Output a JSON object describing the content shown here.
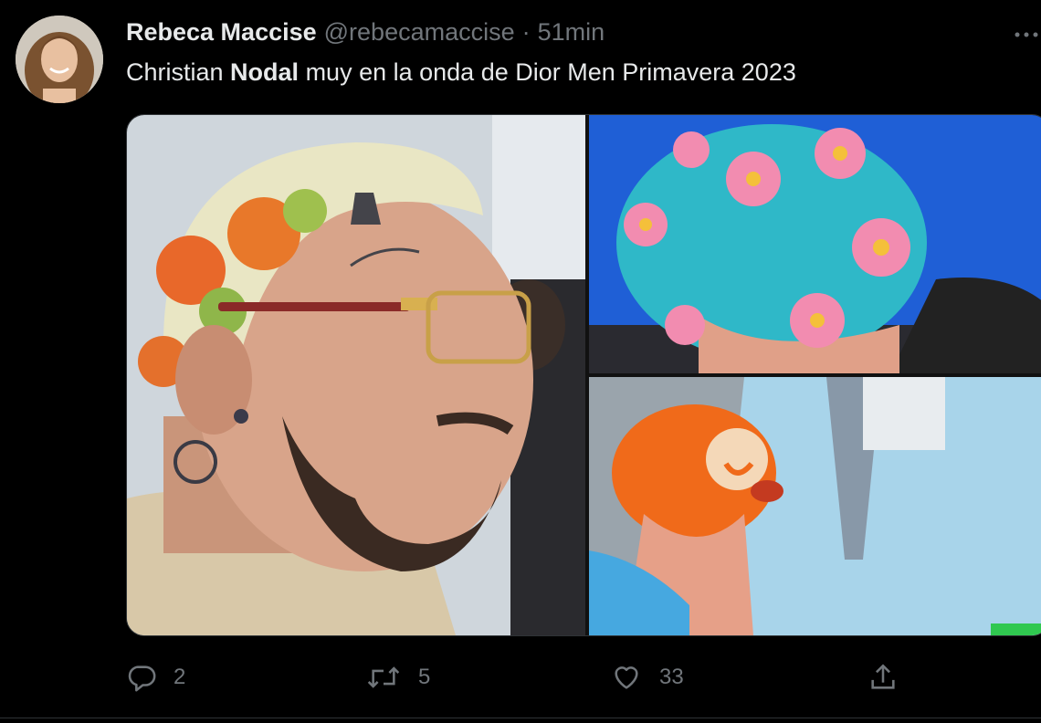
{
  "tweet": {
    "display_name": "Rebeca Maccise",
    "handle": "@rebecamaccise",
    "separator": "·",
    "time": "51min",
    "more_icon": "more-horizontal-icon",
    "text_prefix": "Christian ",
    "text_bold": "Nodal",
    "text_suffix": " muy en la onda de Dior Men Primavera 2023"
  },
  "media": {
    "photos": [
      {
        "alt": "photo-1"
      },
      {
        "alt": "photo-2"
      },
      {
        "alt": "photo-3"
      }
    ]
  },
  "actions": {
    "reply_icon": "reply-icon",
    "reply_count": "2",
    "retweet_icon": "retweet-icon",
    "retweet_count": "5",
    "like_icon": "heart-icon",
    "like_count": "33",
    "share_icon": "share-icon"
  },
  "colors": {
    "background": "#000000",
    "primary_text": "#e7e9ea",
    "secondary_text": "#71767b",
    "border": "#2f3336"
  }
}
